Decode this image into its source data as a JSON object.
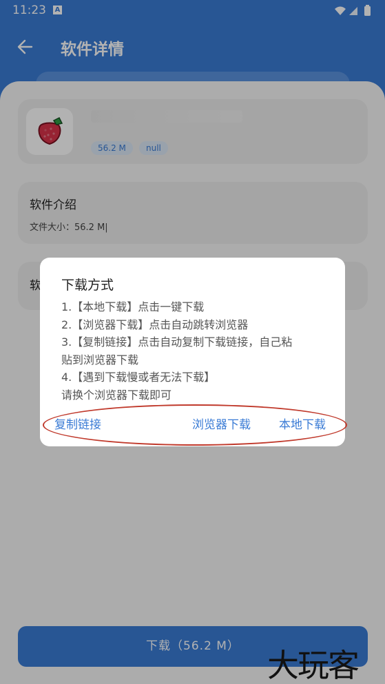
{
  "status": {
    "time": "11:23"
  },
  "header": {
    "title": "软件详情"
  },
  "app": {
    "size_tag": "56.2 M",
    "null_tag": "null"
  },
  "intro": {
    "title": "软件介绍",
    "file_size": "文件大小：56.2 M|"
  },
  "card3": {
    "title": "软"
  },
  "dialog": {
    "title": "下载方式",
    "lines": [
      "1.【本地下载】点击一键下载",
      "2.【浏览器下载】点击自动跳转浏览器",
      "3.【复制链接】点击自动复制下载链接，自己粘",
      "贴到浏览器下载",
      "4.【遇到下载慢或者无法下载】",
      "请换个浏览器下载即可"
    ],
    "copy_link": "复制链接",
    "browser_download": "浏览器下载",
    "local_download": "本地下载"
  },
  "download_button": "下载（56.2 M）",
  "watermark": "大玩客",
  "colors": {
    "primary": "#3a7bd5",
    "annotation": "#c0392b"
  }
}
